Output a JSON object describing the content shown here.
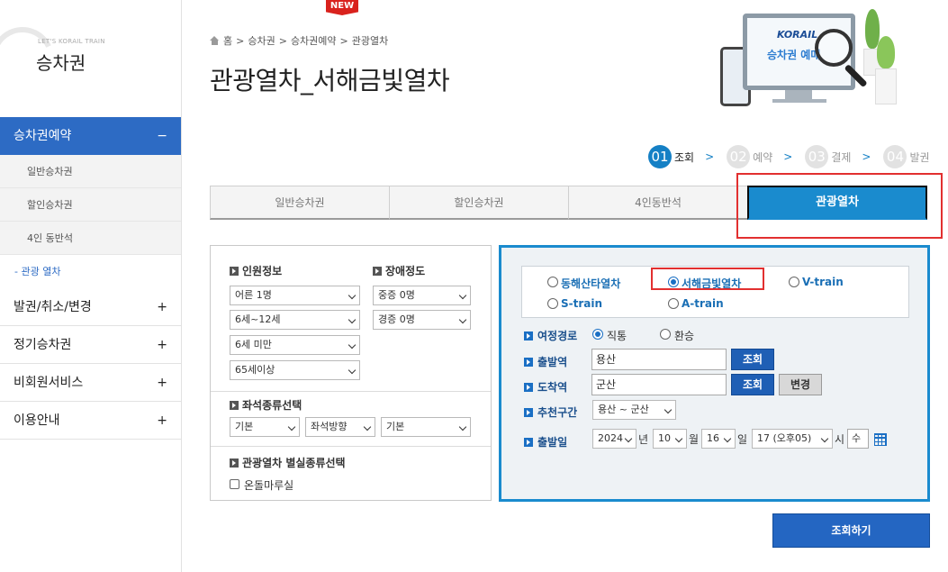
{
  "sidebar": {
    "logo_small": "LET'S KORAIL TRAIN",
    "logo_title": "승차권",
    "menu_reserve": {
      "label": "승차권예약",
      "sign": "−"
    },
    "sub_items": [
      "일반승차권",
      "할인승차권",
      "4인 동반석",
      "관광 열차"
    ],
    "menu_issue": {
      "label": "발권/취소/변경",
      "sign": "+"
    },
    "menu_season": {
      "label": "정기승차권",
      "sign": "+"
    },
    "menu_nonmember": {
      "label": "비회원서비스",
      "sign": "+"
    },
    "menu_guide": {
      "label": "이용안내",
      "sign": "+"
    }
  },
  "breadcrumb": [
    "홈",
    ">",
    "승차권",
    ">",
    "승차권예약",
    ">",
    "관광열차"
  ],
  "page_title": "관광열차_서해금빛열차",
  "promo": {
    "brand": "KORAIL",
    "text": "승차권 예매"
  },
  "steps": [
    {
      "num": "01",
      "label": "조회"
    },
    {
      "num": "02",
      "label": "예약"
    },
    {
      "num": "03",
      "label": "결제"
    },
    {
      "num": "04",
      "label": "발권"
    }
  ],
  "step_arrow": ">",
  "tabs": [
    "일반승차권",
    "할인승차권",
    "4인동반석",
    "관광열차"
  ],
  "new_badge": "NEW",
  "passenger": {
    "title": "인원정보",
    "adult": "어른 1명",
    "child": "6세~12세",
    "infant": "6세 미만",
    "senior": "65세이상"
  },
  "disability": {
    "title": "장애정도",
    "severe": "중증 0명",
    "mild": "경증 0명"
  },
  "seat": {
    "title": "좌석종류선택",
    "type": "기본",
    "direction": "좌석방향",
    "position": "기본"
  },
  "room": {
    "title": "관광열차 별실종류선택",
    "option": "온돌마루실"
  },
  "trains": [
    "동해산타열차",
    "서해금빛열차",
    "V-train",
    "S-train",
    "A-train"
  ],
  "route": {
    "label": "여정경로",
    "direct": "직통",
    "transfer": "환승"
  },
  "departure": {
    "label": "출발역",
    "value": "용산",
    "search": "조회"
  },
  "arrival": {
    "label": "도착역",
    "value": "군산",
    "search": "조회",
    "change": "변경"
  },
  "recommend": {
    "label": "추천구간",
    "value": "용산 ~ 군산"
  },
  "date": {
    "label": "출발일",
    "year": "2024",
    "year_unit": "년",
    "month": "10",
    "month_unit": "월",
    "day": "16",
    "day_unit": "일",
    "hour": "17 (오후05)",
    "hour_unit": "시",
    "weekday": "수"
  },
  "search_button": "조회하기"
}
